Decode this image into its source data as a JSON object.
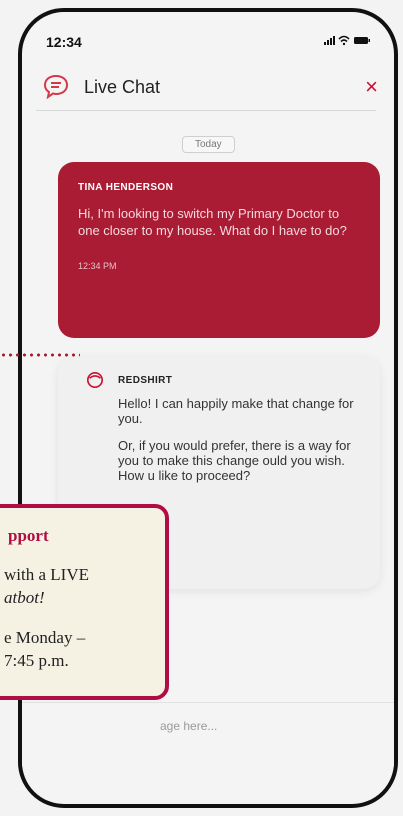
{
  "status_bar": {
    "time": "12:34",
    "icons": "signal-wifi-battery"
  },
  "header": {
    "title": "Live Chat",
    "close_label": "×",
    "icon": "chat-bubble-icon"
  },
  "date_chip": "Today",
  "messages": [
    {
      "sender": "TINA HENDERSON",
      "text": "Hi, I'm looking to switch my Primary Doctor to one closer to my house. What do I have to do?",
      "time": "12:34 PM"
    },
    {
      "sender": "REDSHIRT",
      "paragraphs": [
        "Hello! I can happily make that change for you.",
        "Or, if you would prefer, there is a way for you to make this change ould you wish. How u like to proceed?"
      ]
    }
  ],
  "input": {
    "placeholder": "age here..."
  },
  "callout": {
    "title": "pport",
    "line1": "with a LIVE",
    "line2": "atbot!",
    "line3": "e Monday –",
    "line4": "7:45 p.m."
  },
  "colors": {
    "brand": "#aa1b34",
    "callout_border": "#b10d45",
    "callout_bg": "#f5f2e4"
  }
}
